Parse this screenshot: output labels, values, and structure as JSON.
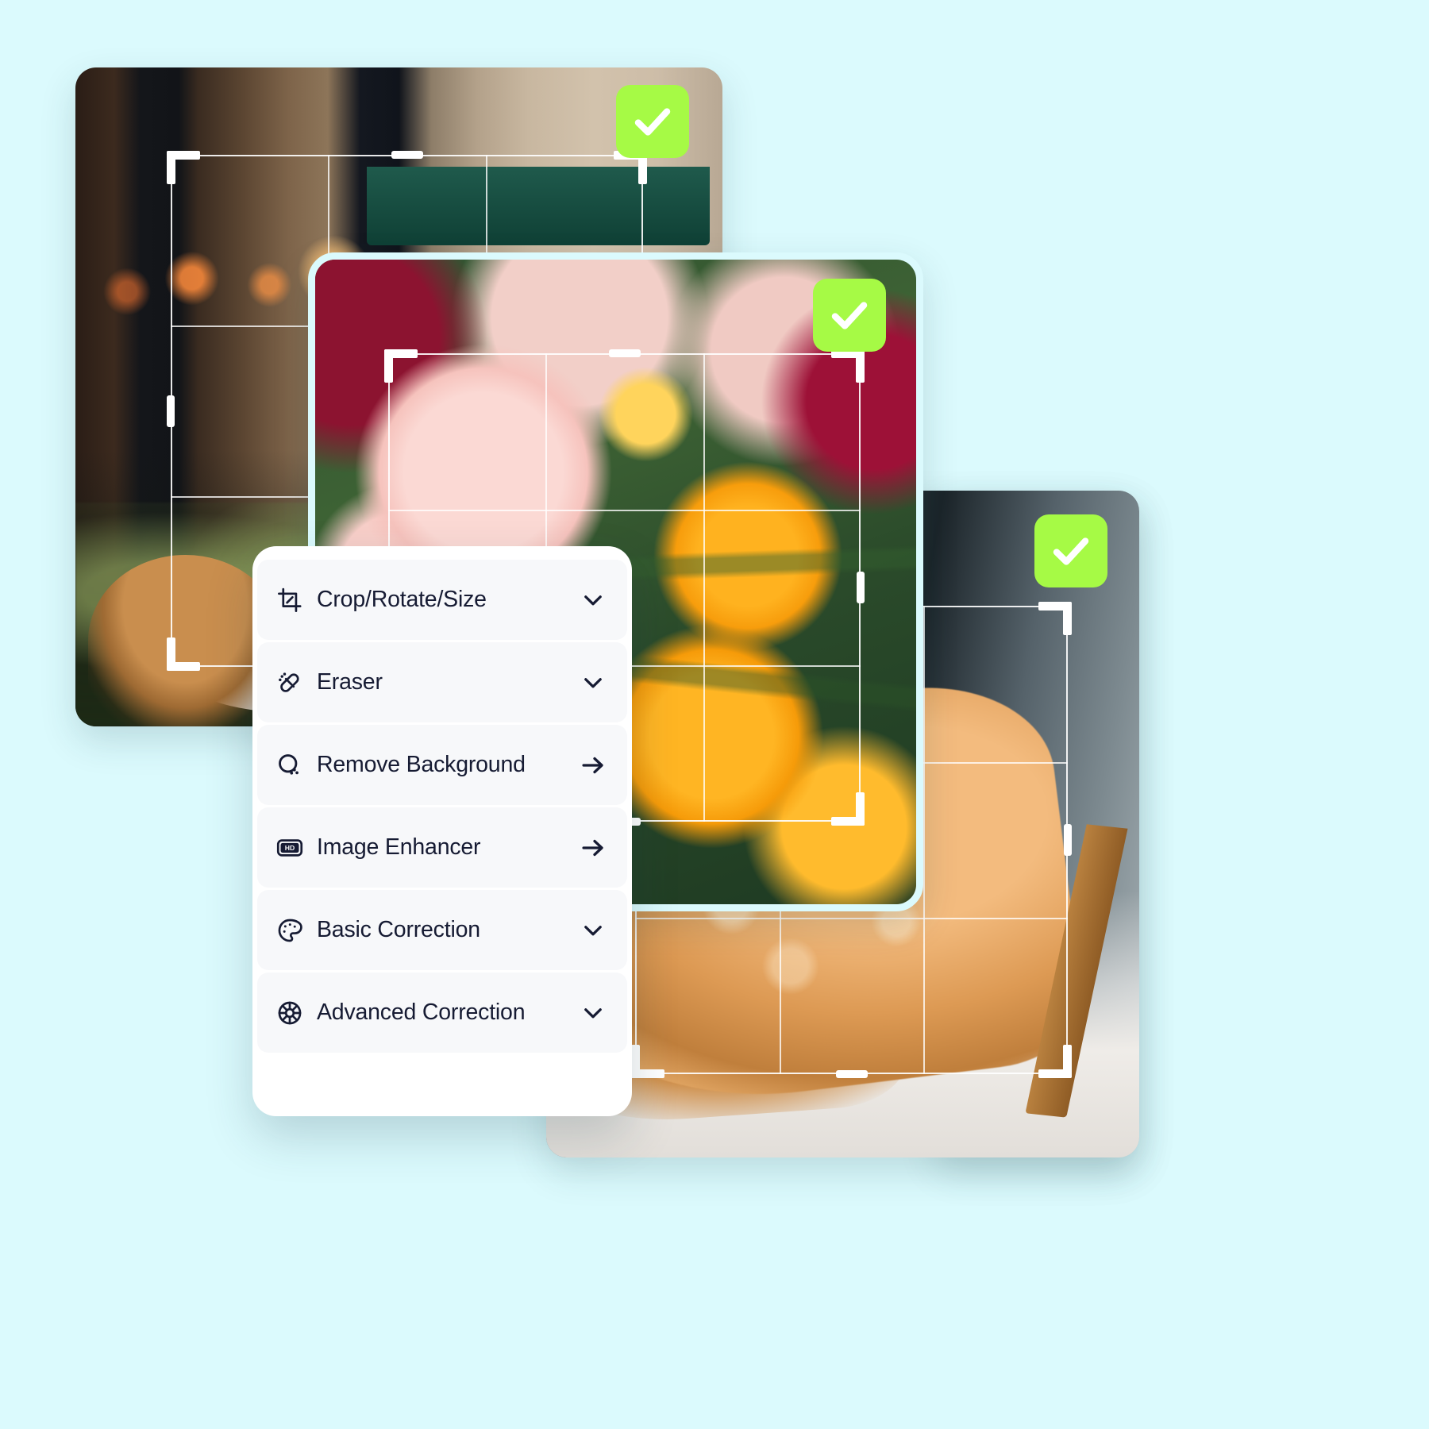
{
  "page": {
    "background_color": "#dbfafd",
    "title": "Photo editor tool menu"
  },
  "cards": [
    {
      "id": "cafe",
      "name": "cafe-photo-card",
      "alt": "Parisian cafe storefront photo",
      "badge": {
        "icon": "check-icon",
        "color": "#a6fa45"
      }
    },
    {
      "id": "flowers",
      "name": "flowers-photo-card",
      "alt": "Pink and yellow gerbera daisies photo",
      "badge": {
        "icon": "check-icon",
        "color": "#a6fa45"
      }
    },
    {
      "id": "shoe",
      "name": "shoe-photo-card",
      "alt": "Orange embroidered high heel shoe photo",
      "badge": {
        "icon": "check-icon",
        "color": "#a6fa45"
      }
    }
  ],
  "menu": {
    "name": "edit-tools-menu",
    "items": [
      {
        "label": "Crop/Rotate/Size",
        "icon": "crop-icon",
        "affordance": "chevron-down-icon"
      },
      {
        "label": "Eraser",
        "icon": "eraser-icon",
        "affordance": "chevron-down-icon"
      },
      {
        "label": "Remove Background",
        "icon": "magic-wand-icon",
        "affordance": "arrow-right-icon"
      },
      {
        "label": "Image Enhancer",
        "icon": "hd-icon",
        "affordance": "arrow-right-icon"
      },
      {
        "label": "Basic Correction",
        "icon": "palette-icon",
        "affordance": "chevron-down-icon"
      },
      {
        "label": "Advanced Correction",
        "icon": "aperture-icon",
        "affordance": "chevron-down-icon"
      }
    ]
  },
  "colors": {
    "accent_green": "#a6fa45",
    "background": "#dbfafd",
    "menu_row": "#f7f8fa",
    "menu_panel": "#ffffff",
    "text": "#161b33",
    "crop_line": "#ffffff"
  }
}
